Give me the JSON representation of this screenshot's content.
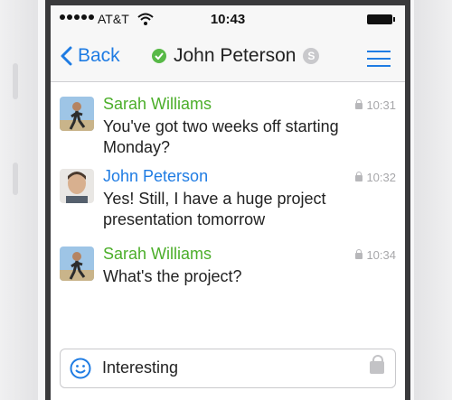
{
  "status_bar": {
    "carrier": "AT&T",
    "time": "10:43"
  },
  "nav": {
    "back_label": "Back",
    "contact_name": "John Peterson",
    "presence": "online",
    "skype_badge": "S"
  },
  "messages": [
    {
      "sender": "Sarah Williams",
      "sender_color": "#4cae2a",
      "time": "10:31",
      "text": "You've got two weeks off starting Monday?"
    },
    {
      "sender": "John Peterson",
      "sender_color": "#1f7ce3",
      "time": "10:32",
      "text": "Yes! Still, I have a huge project presentation tomorrow"
    },
    {
      "sender": "Sarah Williams",
      "sender_color": "#4cae2a",
      "time": "10:34",
      "text": "What's the project?"
    }
  ],
  "composer": {
    "value": "Interesting"
  },
  "colors": {
    "accent": "#1f7ce3",
    "online": "#58b947"
  }
}
